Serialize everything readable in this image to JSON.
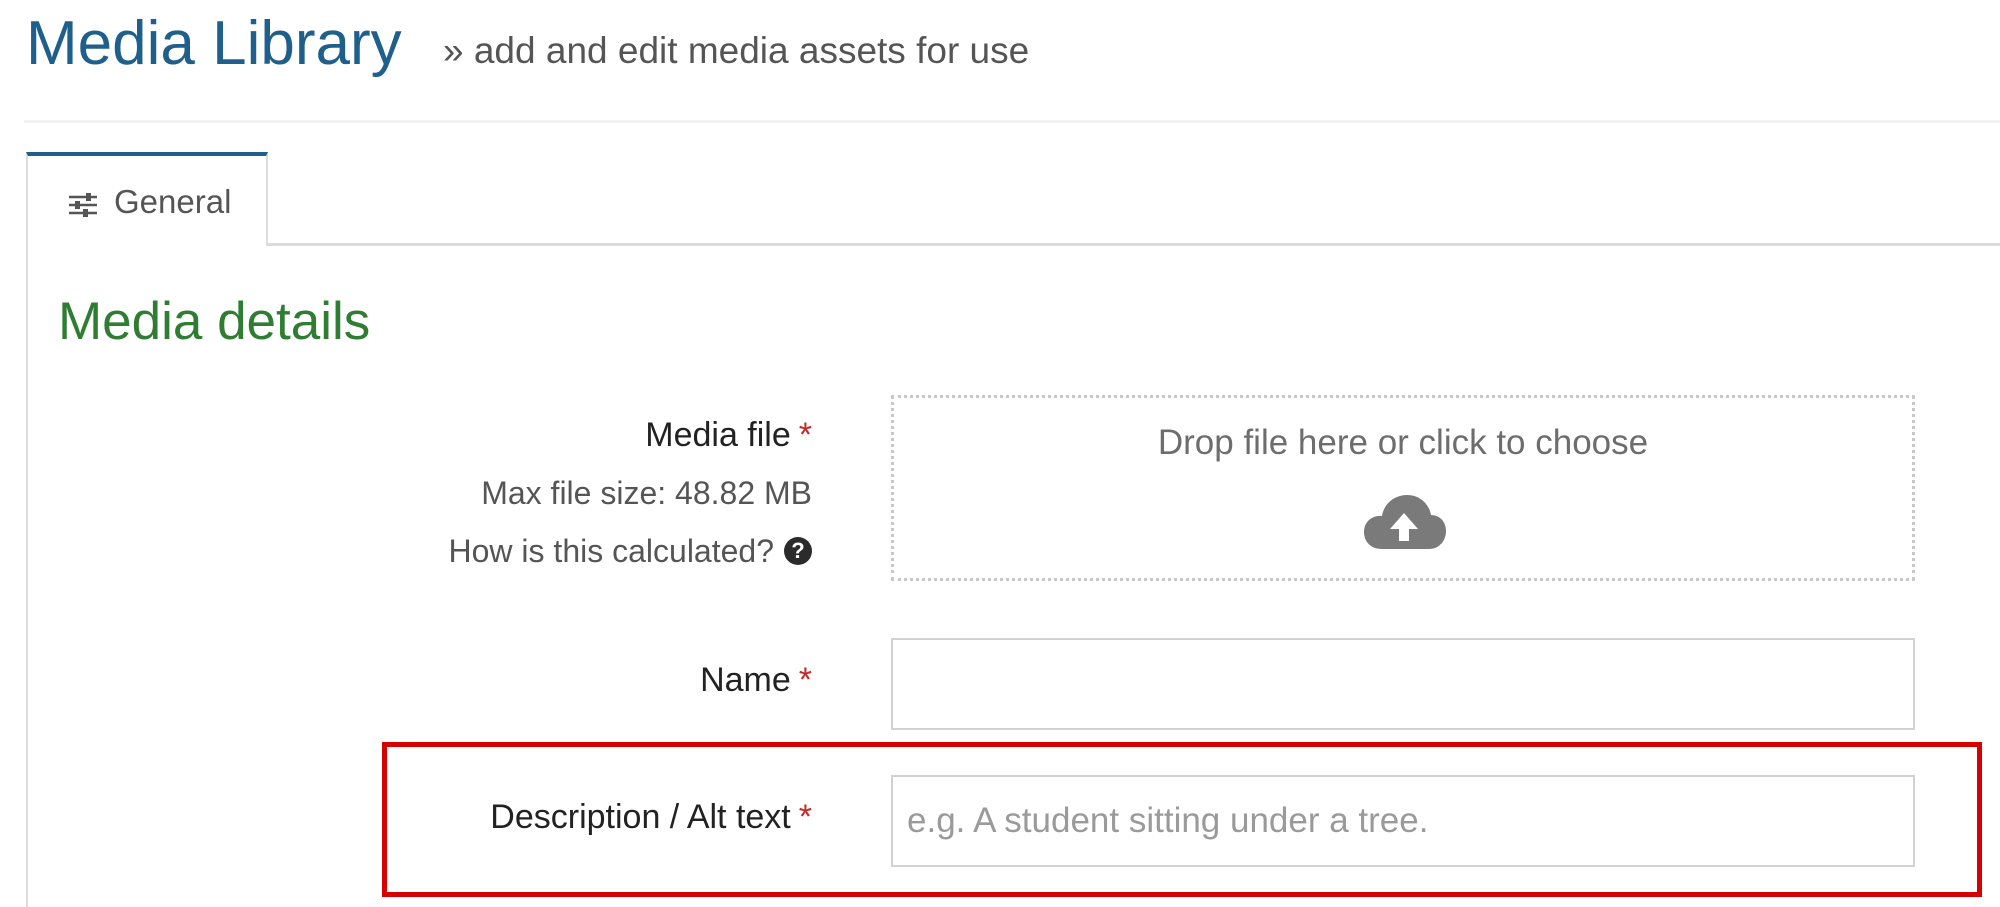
{
  "header": {
    "title": "Media Library",
    "subtitle": "» add and edit media assets for use"
  },
  "tabs": [
    {
      "label": "General",
      "icon": "sliders-icon",
      "active": true
    }
  ],
  "section": {
    "title": "Media details"
  },
  "form": {
    "media_file": {
      "label": "Media file",
      "required_marker": "*",
      "max_size_text": "Max file size: 48.82 MB",
      "help_text": "How is this calculated?",
      "help_icon": "question-circle-icon",
      "dropzone_text": "Drop file here or click to choose",
      "dropzone_icon": "cloud-upload-icon"
    },
    "name": {
      "label": "Name",
      "required_marker": "*",
      "value": "",
      "placeholder": ""
    },
    "description": {
      "label": "Description / Alt text",
      "required_marker": "*",
      "value": "",
      "placeholder": "e.g. A student sitting under a tree."
    }
  },
  "colors": {
    "title_blue": "#1f5f8b",
    "section_green": "#2e7d32",
    "required_red": "#c62828",
    "highlight_red": "#d50000"
  }
}
